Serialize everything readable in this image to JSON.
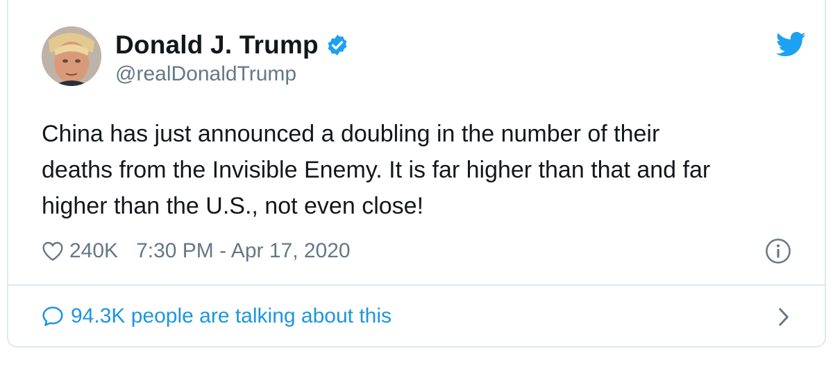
{
  "tweet": {
    "author_name": "Donald J. Trump",
    "handle": "@realDonaldTrump",
    "text_lines": [
      "China has just announced a doubling in the number of their",
      "deaths from the Invisible Enemy. It is far higher than that and far",
      "higher than the U.S., not even close!"
    ],
    "likes": "240K",
    "timestamp": "7:30 PM - Apr 17, 2020",
    "talking": "94.3K people are talking about this"
  },
  "icons": {
    "verified": "verified-badge-icon",
    "brand": "twitter-bird-icon",
    "like": "heart-icon",
    "info": "info-icon",
    "reply": "speech-bubble-icon",
    "open": "chevron-right-icon"
  },
  "colors": {
    "twitter_blue": "#1da1f2",
    "link_blue": "#1b95e0",
    "secondary_text": "#657786",
    "border": "#e1e8ed"
  }
}
